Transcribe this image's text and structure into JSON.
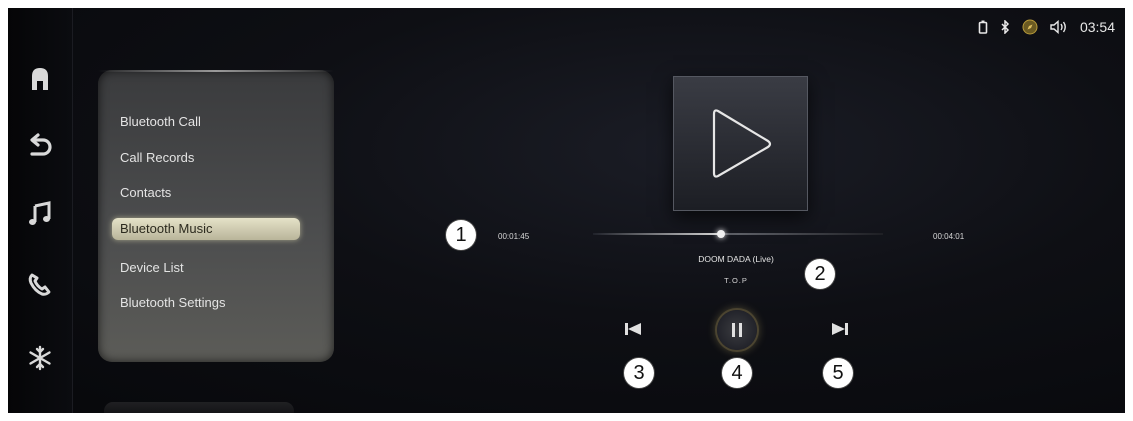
{
  "status": {
    "time": "03:54"
  },
  "sidebar": {
    "items": [
      {
        "icon": "home-icon"
      },
      {
        "icon": "back-icon"
      },
      {
        "icon": "music-icon"
      },
      {
        "icon": "phone-icon"
      },
      {
        "icon": "climate-icon"
      }
    ]
  },
  "menu": {
    "items": [
      {
        "label": "Bluetooth Call"
      },
      {
        "label": "Call Records"
      },
      {
        "label": "Contacts"
      },
      {
        "label": "Bluetooth Music",
        "active": true
      },
      {
        "label": "Device List"
      },
      {
        "label": "Bluetooth Settings"
      }
    ]
  },
  "player": {
    "elapsed": "00:01:45",
    "total": "00:04:01",
    "progress": 0.44,
    "song": "DOOM DADA (Live)",
    "artist": "T.O.P",
    "state": "playing"
  },
  "callouts": [
    "1",
    "2",
    "3",
    "4",
    "5"
  ],
  "colors": {
    "active_menu": "#d8d4b8",
    "panel": "#4a4b4c",
    "background": "#0b0c10"
  }
}
